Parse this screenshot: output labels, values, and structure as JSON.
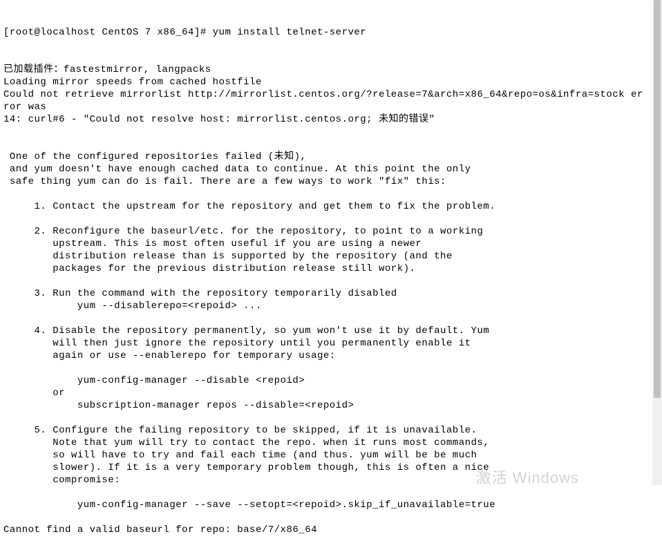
{
  "terminal": {
    "prompt": "[root@localhost CentOS 7 x86_64]# ",
    "command": "yum install telnet-server",
    "lines": [
      "已加载插件：fastestmirror, langpacks",
      "Loading mirror speeds from cached hostfile",
      "Could not retrieve mirrorlist http://mirrorlist.centos.org/?release=7&arch=x86_64&repo=os&infra=stock er",
      "ror was",
      "14: curl#6 - \"Could not resolve host: mirrorlist.centos.org; 未知的错误\"",
      "",
      "",
      " One of the configured repositories failed (未知),",
      " and yum doesn't have enough cached data to continue. At this point the only",
      " safe thing yum can do is fail. There are a few ways to work \"fix\" this:",
      "",
      "     1. Contact the upstream for the repository and get them to fix the problem.",
      "",
      "     2. Reconfigure the baseurl/etc. for the repository, to point to a working",
      "        upstream. This is most often useful if you are using a newer",
      "        distribution release than is supported by the repository (and the",
      "        packages for the previous distribution release still work).",
      "",
      "     3. Run the command with the repository temporarily disabled",
      "            yum --disablerepo=<repoid> ...",
      "",
      "     4. Disable the repository permanently, so yum won't use it by default. Yum",
      "        will then just ignore the repository until you permanently enable it",
      "        again or use --enablerepo for temporary usage:",
      "",
      "            yum-config-manager --disable <repoid>",
      "        or",
      "            subscription-manager repos --disable=<repoid>",
      "",
      "     5. Configure the failing repository to be skipped, if it is unavailable.",
      "        Note that yum will try to contact the repo. when it runs most commands,",
      "        so will have to try and fail each time (and thus. yum will be be much",
      "        slower). If it is a very temporary problem though, this is often a nice",
      "        compromise:",
      "",
      "            yum-config-manager --save --setopt=<repoid>.skip_if_unavailable=true",
      "",
      "Cannot find a valid baseurl for repo: base/7/x86_64"
    ]
  },
  "watermark": "激活 Windows"
}
